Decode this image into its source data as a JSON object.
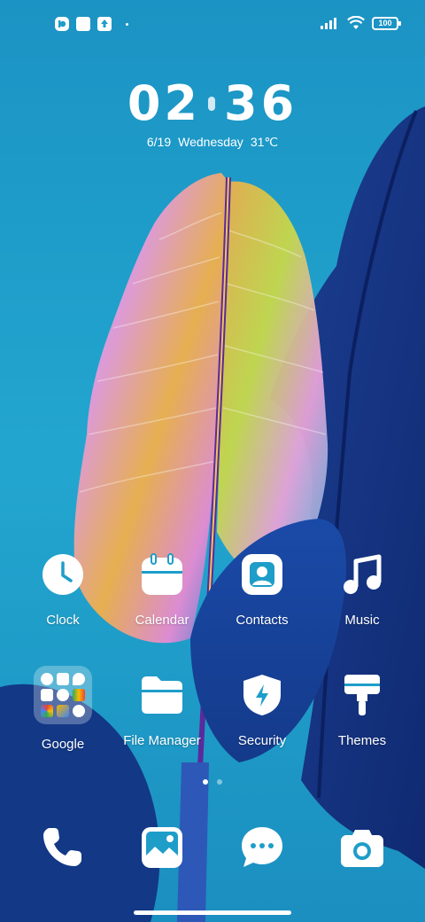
{
  "status_bar": {
    "battery_level": "100",
    "signal_bars": 4,
    "notification_icons": [
      "app-notification-icon",
      "square-notification-icon",
      "upload-notification-icon"
    ]
  },
  "clock_widget": {
    "hours": "02",
    "minutes": "36",
    "date": "6/19",
    "weekday": "Wednesday",
    "temperature": "31℃"
  },
  "apps": {
    "clock": {
      "label": "Clock",
      "icon": "clock-icon"
    },
    "calendar": {
      "label": "Calendar",
      "icon": "calendar-icon"
    },
    "contacts": {
      "label": "Contacts",
      "icon": "contacts-icon"
    },
    "music": {
      "label": "Music",
      "icon": "music-note-icon"
    },
    "google": {
      "label": "Google",
      "icon": "folder-icon"
    },
    "file_manager": {
      "label": "File Manager",
      "icon": "folder-icon"
    },
    "security": {
      "label": "Security",
      "icon": "shield-bolt-icon"
    },
    "themes": {
      "label": "Themes",
      "icon": "paint-roller-icon"
    }
  },
  "page_indicator": {
    "current": 1,
    "total": 2
  },
  "dock": [
    "phone-icon",
    "gallery-icon",
    "messages-icon",
    "camera-icon"
  ],
  "colors": {
    "wallpaper_sky": "#1e9dc9",
    "icon": "#ffffff"
  }
}
